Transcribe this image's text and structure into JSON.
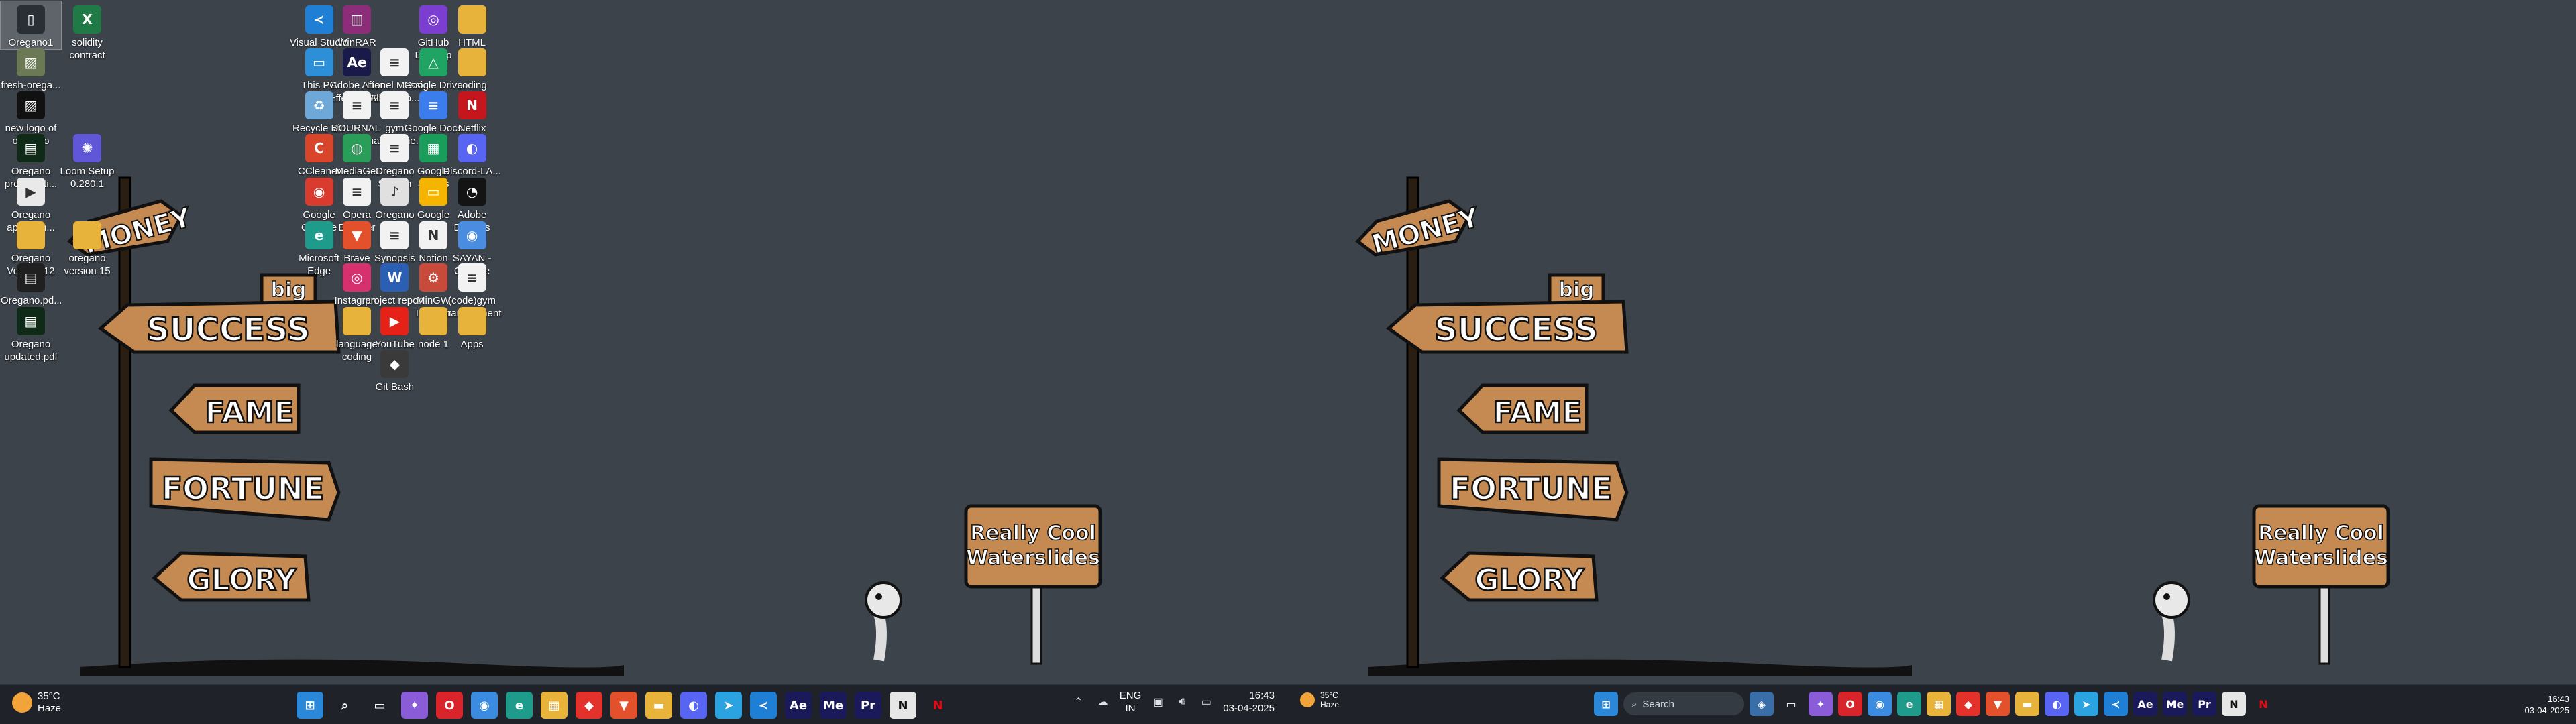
{
  "left": {
    "desktop_icons": [
      {
        "label": "Oregano1",
        "icon": "file-icon",
        "color": "#2a2f35",
        "selected": true
      },
      {
        "label": "solidity contract",
        "icon": "excel-icon",
        "color": "#1f7a45"
      },
      {
        "label": "fresh-orega...",
        "icon": "image-icon",
        "color": "#6b7a55"
      },
      {
        "label": "new logo of oregano",
        "icon": "image-icon",
        "color": "#111111"
      },
      {
        "label": "Oregano presentati...",
        "icon": "pdf-icon",
        "color": "#0f2a17"
      },
      {
        "label": "Loom Setup 0.280.1",
        "icon": "loom-icon",
        "color": "#6056d8"
      },
      {
        "label": "Oregano app-dem...",
        "icon": "video-icon",
        "color": "#e9e9e9"
      },
      {
        "label": "Oregano Version 12",
        "icon": "folder-icon",
        "color": "#e8b33a"
      },
      {
        "label": "oregano version 15",
        "icon": "folder-icon",
        "color": "#e8b33a"
      },
      {
        "label": "Oregano.pd... deck",
        "icon": "pdf-icon",
        "color": "#202020"
      },
      {
        "label": "Oregano updated.pdf",
        "icon": "pdf-icon",
        "color": "#0f2a17"
      },
      {
        "label": "Visual Studio Code",
        "icon": "vscode-icon",
        "color": "#1f7fd4"
      },
      {
        "label": "WinRAR",
        "icon": "winrar-icon",
        "color": "#8c2d7a"
      },
      {
        "label": "GitHub Desktop",
        "icon": "github-icon",
        "color": "#7b3ed0"
      },
      {
        "label": "HTML",
        "icon": "folder-icon",
        "color": "#e8b33a"
      },
      {
        "label": "This PC",
        "icon": "monitor-icon",
        "color": "#2c8fd8"
      },
      {
        "label": "Adobe After Effects 2022",
        "icon": "after-effects-icon",
        "color": "#1a1a4a"
      },
      {
        "label": "Lionel Messi All 91 Go...",
        "icon": "document-icon",
        "color": "#f2f2f2"
      },
      {
        "label": "Google Drive",
        "icon": "drive-icon",
        "color": "#1fa463"
      },
      {
        "label": "coding",
        "icon": "folder-icon",
        "color": "#e8b33a"
      },
      {
        "label": "Recycle Bin",
        "icon": "recycle-bin-icon",
        "color": "#6da8d8"
      },
      {
        "label": "JOURNAL OF A PSYCHOP...",
        "icon": "document-icon",
        "color": "#f2f2f2"
      },
      {
        "label": "gym manageme...",
        "icon": "document-icon",
        "color": "#f2f2f2"
      },
      {
        "label": "Google Docs",
        "icon": "docs-icon",
        "color": "#3b7ded"
      },
      {
        "label": "Netflix",
        "icon": "netflix-icon",
        "color": "#c4161c"
      },
      {
        "label": "CCleaner",
        "icon": "ccleaner-icon",
        "color": "#d8452b"
      },
      {
        "label": "MediaGet",
        "icon": "mediaget-icon",
        "color": "#2a9d59"
      },
      {
        "label": "Oregano System wor...",
        "icon": "document-icon",
        "color": "#f2f2f2"
      },
      {
        "label": "Google Sheets",
        "icon": "sheets-icon",
        "color": "#1a9c5a"
      },
      {
        "label": "Discord-LA...",
        "icon": "discord-icon",
        "color": "#5865f2"
      },
      {
        "label": "Google Chrome",
        "icon": "chrome-icon",
        "color": "#d93b2f"
      },
      {
        "label": "Opera Browser",
        "icon": "document-icon",
        "color": "#f2f2f2"
      },
      {
        "label": "Oregano",
        "icon": "audio-icon",
        "color": "#e0e0e0"
      },
      {
        "label": "Google Slides",
        "icon": "slides-icon",
        "color": "#f4b400"
      },
      {
        "label": "Adobe Express",
        "icon": "adobe-express-icon",
        "color": "#141414"
      },
      {
        "label": "Microsoft Edge",
        "icon": "edge-icon",
        "color": "#1f9b8c"
      },
      {
        "label": "Brave",
        "icon": "brave-icon",
        "color": "#e2512b"
      },
      {
        "label": "Synopsis gym management",
        "icon": "document-icon",
        "color": "#f2f2f2"
      },
      {
        "label": "Notion",
        "icon": "notion-icon",
        "color": "#f2f2f2"
      },
      {
        "label": "SAYAN - Chrome",
        "icon": "chrome-profile-icon",
        "color": "#4a8ce0"
      },
      {
        "label": "Instagram",
        "icon": "instagram-icon",
        "color": "#d6306e"
      },
      {
        "label": "project report on g...",
        "icon": "word-icon",
        "color": "#2b5fb4"
      },
      {
        "label": "MinGW Installer",
        "icon": "installer-icon",
        "color": "#c84a3a"
      },
      {
        "label": "(code)gym management",
        "icon": "document-icon",
        "color": "#f2f2f2"
      },
      {
        "label": "language coding",
        "icon": "folder-icon",
        "color": "#e8b33a"
      },
      {
        "label": "YouTube",
        "icon": "youtube-icon",
        "color": "#e62117"
      },
      {
        "label": "node 1",
        "icon": "folder-icon",
        "color": "#e8b33a"
      },
      {
        "label": "Apps",
        "icon": "folder-icon",
        "color": "#e8b33a"
      },
      {
        "label": "Git Bash",
        "icon": "git-bash-icon",
        "color": "#3a3a3a"
      }
    ],
    "wallpaper": {
      "signs": [
        "MONEY",
        "big",
        "SUCCESS",
        "FAME",
        "FORTUNE",
        "GLORY"
      ],
      "board": [
        "Really Cool",
        "Waterslides"
      ]
    },
    "taskbar": {
      "weather_temp": "35°C",
      "weather_cond": "Haze",
      "weather_badge": "1",
      "apps": [
        {
          "icon": "windows-start-icon",
          "color": "#2b88d8",
          "glyph": "⊞"
        },
        {
          "icon": "search-icon",
          "color": "transparent",
          "glyph": "⌕"
        },
        {
          "icon": "task-view-icon",
          "color": "transparent",
          "glyph": "▭"
        },
        {
          "icon": "copilot-icon",
          "color": "#8a5cd8",
          "glyph": "✦"
        },
        {
          "icon": "opera-icon",
          "color": "#d9242b",
          "glyph": "O"
        },
        {
          "icon": "chrome-icon",
          "color": "#3b8ce0",
          "glyph": "◉"
        },
        {
          "icon": "edge-icon",
          "color": "#1f9b8c",
          "glyph": "e"
        },
        {
          "icon": "calendar-icon",
          "color": "#e8b33a",
          "glyph": "▦"
        },
        {
          "icon": "gem-icon",
          "color": "#e2322b",
          "glyph": "◆"
        },
        {
          "icon": "brave-icon",
          "color": "#e2512b",
          "glyph": "▼"
        },
        {
          "icon": "file-explorer-icon",
          "color": "#e8b33a",
          "glyph": "▬"
        },
        {
          "icon": "discord-icon",
          "color": "#5865f2",
          "glyph": "◐"
        },
        {
          "icon": "telegram-icon",
          "color": "#2aa3e0",
          "glyph": "➤"
        },
        {
          "icon": "vscode-icon",
          "color": "#1f7fd4",
          "glyph": "≺"
        },
        {
          "icon": "after-effects-icon",
          "color": "#1a1a5a",
          "glyph": "Ae"
        },
        {
          "icon": "media-encoder-icon",
          "color": "#1a1a5a",
          "glyph": "Me"
        },
        {
          "icon": "premiere-icon",
          "color": "#1a1a5a",
          "glyph": "Pr"
        },
        {
          "icon": "notion-icon",
          "color": "#e6e6e6",
          "glyph": "N"
        },
        {
          "icon": "netflix-icon",
          "color": "transparent",
          "glyph": "N"
        }
      ],
      "lang_line1": "ENG",
      "lang_line2": "IN",
      "time": "16:43",
      "date": "03-04-2025"
    }
  },
  "right": {
    "taskbar": {
      "weather_temp": "35°C",
      "weather_cond": "Haze",
      "search_placeholder": "Search",
      "time": "16:43",
      "date": "03-04-2025",
      "apps": [
        {
          "icon": "widgets-icon",
          "color": "#3a6ea8",
          "glyph": "◈"
        },
        {
          "icon": "task-view-icon",
          "color": "transparent",
          "glyph": "▭"
        },
        {
          "icon": "copilot-icon",
          "color": "#8a5cd8",
          "glyph": "✦"
        },
        {
          "icon": "opera-icon",
          "color": "#d9242b",
          "glyph": "O"
        },
        {
          "icon": "chrome-icon",
          "color": "#3b8ce0",
          "glyph": "◉"
        },
        {
          "icon": "edge-icon",
          "color": "#1f9b8c",
          "glyph": "e"
        },
        {
          "icon": "calendar-icon",
          "color": "#e8b33a",
          "glyph": "▦"
        },
        {
          "icon": "gem-icon",
          "color": "#e2322b",
          "glyph": "◆"
        },
        {
          "icon": "brave-icon",
          "color": "#e2512b",
          "glyph": "▼"
        },
        {
          "icon": "file-explorer-icon",
          "color": "#e8b33a",
          "glyph": "▬"
        },
        {
          "icon": "discord-icon",
          "color": "#5865f2",
          "glyph": "◐"
        },
        {
          "icon": "telegram-icon",
          "color": "#2aa3e0",
          "glyph": "➤"
        },
        {
          "icon": "vscode-icon",
          "color": "#1f7fd4",
          "glyph": "≺"
        },
        {
          "icon": "after-effects-icon",
          "color": "#1a1a5a",
          "glyph": "Ae"
        },
        {
          "icon": "media-encoder-icon",
          "color": "#1a1a5a",
          "glyph": "Me"
        },
        {
          "icon": "premiere-icon",
          "color": "#1a1a5a",
          "glyph": "Pr"
        },
        {
          "icon": "notion-icon",
          "color": "#e6e6e6",
          "glyph": "N"
        },
        {
          "icon": "netflix-icon",
          "color": "transparent",
          "glyph": "N"
        }
      ]
    },
    "wallpaper": {
      "signs": [
        "MONEY",
        "big",
        "SUCCESS",
        "FAME",
        "FORTUNE",
        "GLORY"
      ],
      "board": [
        "Really Cool",
        "Waterslides"
      ]
    }
  }
}
